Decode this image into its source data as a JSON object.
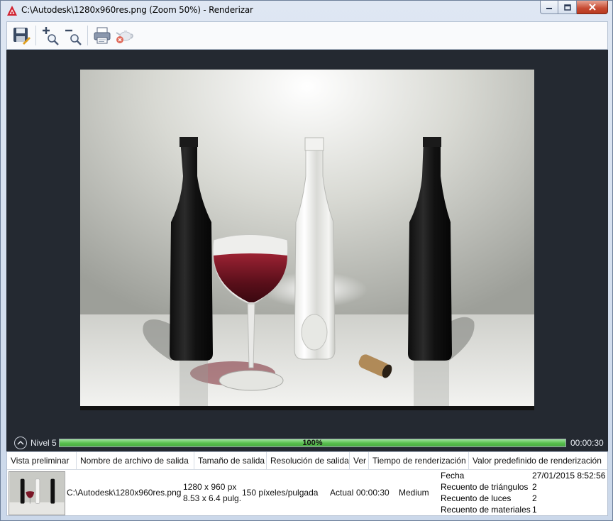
{
  "window": {
    "title": "C:\\Autodesk\\1280x960res.png (Zoom 50%) - Renderizar"
  },
  "toolbar": {
    "buttons": [
      {
        "icon": "save-icon"
      },
      {
        "icon": "zoom-in-icon"
      },
      {
        "icon": "zoom-out-icon"
      },
      {
        "icon": "print-icon"
      },
      {
        "icon": "teapot-cancel-icon"
      }
    ]
  },
  "progress": {
    "level_label": "Nivel 5",
    "percent_text": "100%",
    "fraction": 1.0,
    "elapsed": "00:00:30"
  },
  "history": {
    "headers": [
      "Vista preliminar",
      "Nombre de archivo de salida",
      "Tamaño de salida",
      "Resolución de salida",
      "Ver",
      "Tiempo de renderización",
      "Valor predefinido de renderización"
    ],
    "row": {
      "filename": "C:\\Autodesk\\1280x960res.png",
      "size_px": "1280 x 960 px",
      "size_in": "8.53 x 6.4 pulg.",
      "resolution": "150 píxeles/pulgada",
      "view": "Actual",
      "time": "00:00:30",
      "preset": "Medium"
    },
    "details": [
      {
        "label": "Fecha",
        "value": "27/01/2015 8:52:56"
      },
      {
        "label": "Recuento de triángulos",
        "value": "2"
      },
      {
        "label": "Recuento de luces",
        "value": "2"
      },
      {
        "label": "Recuento de materiales",
        "value": "1"
      }
    ]
  },
  "colors": {
    "accent_red": "#c8102e",
    "canvas_bg": "#242931",
    "progress_green": "#56bd4c"
  }
}
